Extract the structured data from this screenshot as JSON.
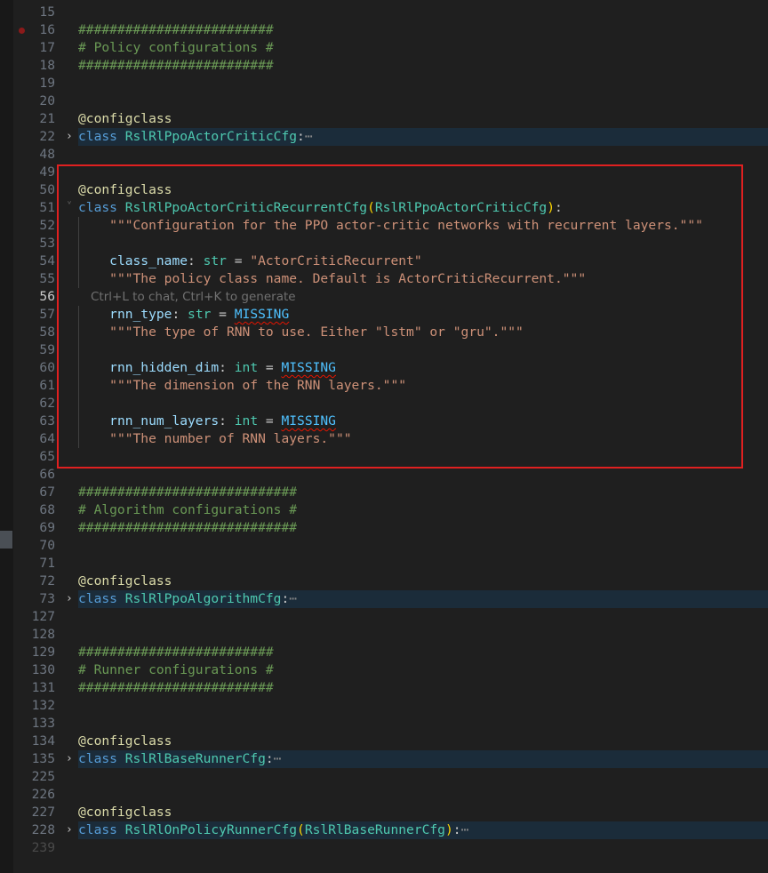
{
  "selection_color": "#e02020",
  "hint_text": "Ctrl+L to chat, Ctrl+K to generate",
  "lines": [
    {
      "n": "15",
      "code": []
    },
    {
      "n": "16",
      "breakpoint": true,
      "code": [
        [
          "comment",
          "#########################"
        ]
      ]
    },
    {
      "n": "17",
      "code": [
        [
          "comment",
          "# Policy configurations #"
        ]
      ]
    },
    {
      "n": "18",
      "code": [
        [
          "comment",
          "#########################"
        ]
      ]
    },
    {
      "n": "19",
      "code": []
    },
    {
      "n": "20",
      "code": []
    },
    {
      "n": "21",
      "code": [
        [
          "dec",
          "@configclass"
        ]
      ]
    },
    {
      "n": "22",
      "fold": "closed",
      "hl": true,
      "code": [
        [
          "kw",
          "class "
        ],
        [
          "cls",
          "RslRlPpoActorCriticCfg"
        ],
        [
          "plain",
          ":"
        ],
        [
          "ell",
          "⋯"
        ]
      ]
    },
    {
      "n": "48",
      "code": []
    },
    {
      "n": "49",
      "code": []
    },
    {
      "n": "50",
      "code": [
        [
          "dec",
          "@configclass"
        ]
      ]
    },
    {
      "n": "51",
      "fold": "open",
      "code": [
        [
          "kw",
          "class "
        ],
        [
          "cls",
          "RslRlPpoActorCriticRecurrentCfg"
        ],
        [
          "paren",
          "("
        ],
        [
          "cls",
          "RslRlPpoActorCriticCfg"
        ],
        [
          "paren",
          ")"
        ],
        [
          "plain",
          ":"
        ]
      ]
    },
    {
      "n": "52",
      "guide": true,
      "code": [
        [
          "plain",
          "    "
        ],
        [
          "str",
          "\"\"\"Configuration for the PPO actor-critic networks with recurrent layers.\"\"\""
        ]
      ]
    },
    {
      "n": "53",
      "guide": true,
      "code": []
    },
    {
      "n": "54",
      "guide": true,
      "code": [
        [
          "plain",
          "    "
        ],
        [
          "var",
          "class_name"
        ],
        [
          "plain",
          ": "
        ],
        [
          "cls",
          "str"
        ],
        [
          "plain",
          " = "
        ],
        [
          "str",
          "\"ActorCriticRecurrent\""
        ]
      ]
    },
    {
      "n": "55",
      "guide": true,
      "code": [
        [
          "plain",
          "    "
        ],
        [
          "str",
          "\"\"\"The policy class name. Default is ActorCriticRecurrent.\"\"\""
        ]
      ]
    },
    {
      "n": "56",
      "active": true,
      "hint": true,
      "code": []
    },
    {
      "n": "57",
      "guide": true,
      "code": [
        [
          "plain",
          "    "
        ],
        [
          "var",
          "rnn_type"
        ],
        [
          "plain",
          ": "
        ],
        [
          "cls",
          "str"
        ],
        [
          "plain",
          " = "
        ],
        [
          "const",
          "MISSING"
        ]
      ]
    },
    {
      "n": "58",
      "guide": true,
      "code": [
        [
          "plain",
          "    "
        ],
        [
          "str",
          "\"\"\"The type of RNN to use. Either \"lstm\" or \"gru\".\"\"\""
        ]
      ]
    },
    {
      "n": "59",
      "guide": true,
      "code": []
    },
    {
      "n": "60",
      "guide": true,
      "code": [
        [
          "plain",
          "    "
        ],
        [
          "var",
          "rnn_hidden_dim"
        ],
        [
          "plain",
          ": "
        ],
        [
          "cls",
          "int"
        ],
        [
          "plain",
          " = "
        ],
        [
          "const",
          "MISSING"
        ]
      ]
    },
    {
      "n": "61",
      "guide": true,
      "code": [
        [
          "plain",
          "    "
        ],
        [
          "str",
          "\"\"\"The dimension of the RNN layers.\"\"\""
        ]
      ]
    },
    {
      "n": "62",
      "guide": true,
      "code": []
    },
    {
      "n": "63",
      "guide": true,
      "code": [
        [
          "plain",
          "    "
        ],
        [
          "var",
          "rnn_num_layers"
        ],
        [
          "plain",
          ": "
        ],
        [
          "cls",
          "int"
        ],
        [
          "plain",
          " = "
        ],
        [
          "const",
          "MISSING"
        ]
      ]
    },
    {
      "n": "64",
      "guide": true,
      "code": [
        [
          "plain",
          "    "
        ],
        [
          "str",
          "\"\"\"The number of RNN layers.\"\"\""
        ]
      ]
    },
    {
      "n": "65",
      "code": []
    },
    {
      "n": "66",
      "code": []
    },
    {
      "n": "67",
      "code": [
        [
          "comment",
          "############################"
        ]
      ]
    },
    {
      "n": "68",
      "code": [
        [
          "comment",
          "# Algorithm configurations #"
        ]
      ]
    },
    {
      "n": "69",
      "code": [
        [
          "comment",
          "############################"
        ]
      ]
    },
    {
      "n": "70",
      "code": []
    },
    {
      "n": "71",
      "code": []
    },
    {
      "n": "72",
      "code": [
        [
          "dec",
          "@configclass"
        ]
      ]
    },
    {
      "n": "73",
      "fold": "closed",
      "hl": true,
      "code": [
        [
          "kw",
          "class "
        ],
        [
          "cls",
          "RslRlPpoAlgorithmCfg"
        ],
        [
          "plain",
          ":"
        ],
        [
          "ell",
          "⋯"
        ]
      ]
    },
    {
      "n": "127",
      "code": []
    },
    {
      "n": "128",
      "code": []
    },
    {
      "n": "129",
      "code": [
        [
          "comment",
          "#########################"
        ]
      ]
    },
    {
      "n": "130",
      "code": [
        [
          "comment",
          "# Runner configurations #"
        ]
      ]
    },
    {
      "n": "131",
      "code": [
        [
          "comment",
          "#########################"
        ]
      ]
    },
    {
      "n": "132",
      "code": []
    },
    {
      "n": "133",
      "code": []
    },
    {
      "n": "134",
      "code": [
        [
          "dec",
          "@configclass"
        ]
      ]
    },
    {
      "n": "135",
      "fold": "closed",
      "hl": true,
      "code": [
        [
          "kw",
          "class "
        ],
        [
          "cls",
          "RslRlBaseRunnerCfg"
        ],
        [
          "plain",
          ":"
        ],
        [
          "ell",
          "⋯"
        ]
      ]
    },
    {
      "n": "225",
      "code": []
    },
    {
      "n": "226",
      "code": []
    },
    {
      "n": "227",
      "code": [
        [
          "dec",
          "@configclass"
        ]
      ]
    },
    {
      "n": "228",
      "fold": "closed",
      "hl": true,
      "code": [
        [
          "kw",
          "class "
        ],
        [
          "cls",
          "RslRlOnPolicyRunnerCfg"
        ],
        [
          "paren",
          "("
        ],
        [
          "cls",
          "RslRlBaseRunnerCfg"
        ],
        [
          "paren",
          ")"
        ],
        [
          "plain",
          ":"
        ],
        [
          "ell",
          "⋯"
        ]
      ]
    },
    {
      "n": "239",
      "dim": true,
      "code": []
    }
  ]
}
